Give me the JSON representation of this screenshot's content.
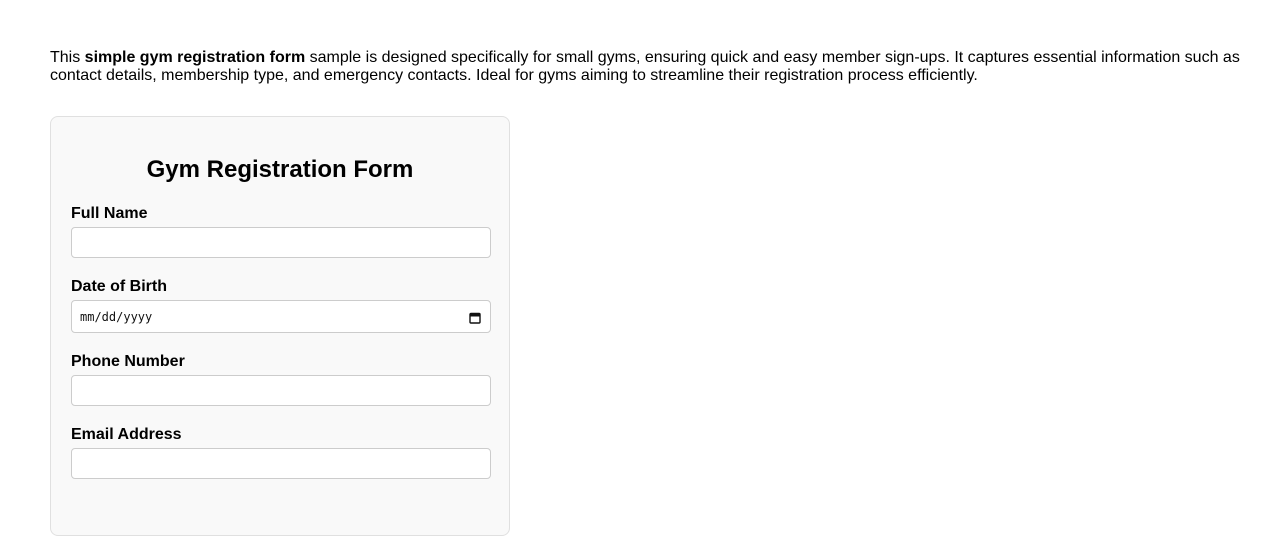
{
  "intro": {
    "lead": "This ",
    "highlight": "simple gym registration form",
    "rest": " sample is designed specifically for small gyms, ensuring quick and easy member sign-ups. It captures essential information such as contact details, membership type, and emergency contacts. Ideal for gyms aiming to streamline their registration process efficiently."
  },
  "form": {
    "title": "Gym Registration Form",
    "fields": [
      {
        "label": "Full Name",
        "value": ""
      },
      {
        "label": "Date of Birth",
        "placeholder": "mm/dd/yyyy"
      },
      {
        "label": "Phone Number",
        "value": ""
      },
      {
        "label": "Email Address",
        "value": ""
      }
    ]
  },
  "colors": {
    "card_background": "#f9f9f9",
    "card_border": "#e0e0e0",
    "input_border": "#cccccc"
  },
  "icons": {
    "date_picker": "calendar-icon"
  }
}
